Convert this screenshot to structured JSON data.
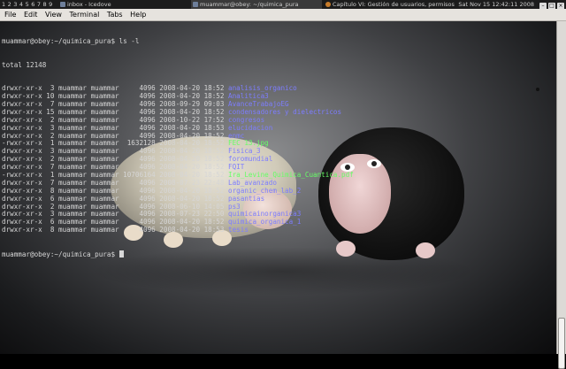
{
  "taskbar": {
    "workspaces": [
      "1",
      "2",
      "3",
      "4",
      "5",
      "6",
      "7",
      "8",
      "9"
    ],
    "tasks": [
      {
        "label": "inbox - Icedove",
        "active": false
      },
      {
        "label": "muammar@obey: ~/quimica_pura",
        "active": true
      },
      {
        "label": "Capítulo VI: Gestión de usuarios, permisos y gr...",
        "active": false
      }
    ],
    "clock": "Sat Nov 15 12:42:11 2008"
  },
  "menubar": [
    "File",
    "Edit",
    "View",
    "Terminal",
    "Tabs",
    "Help"
  ],
  "terminal": {
    "prompt_cmd": "muammar@obey:~/quimica_pura$ ls -l",
    "total": "total 12148",
    "entries": [
      {
        "perm": "drwxr-xr-x",
        "links": "3",
        "user": "muammar",
        "group": "muammar",
        "size": "4096",
        "date": "2008-04-20",
        "time": "18:52",
        "name": "analisis_organico",
        "kind": "dir"
      },
      {
        "perm": "drwxr-xr-x",
        "links": "10",
        "user": "muammar",
        "group": "muammar",
        "size": "4096",
        "date": "2008-04-20",
        "time": "18:52",
        "name": "Analitica3",
        "kind": "dir"
      },
      {
        "perm": "drwxr-xr-x",
        "links": "7",
        "user": "muammar",
        "group": "muammar",
        "size": "4096",
        "date": "2008-09-29",
        "time": "09:03",
        "name": "AvanceTrabajoEG",
        "kind": "dir"
      },
      {
        "perm": "drwxr-xr-x",
        "links": "15",
        "user": "muammar",
        "group": "muammar",
        "size": "4096",
        "date": "2008-04-20",
        "time": "18:52",
        "name": "condensadores y dielectricos",
        "kind": "dir"
      },
      {
        "perm": "drwxr-xr-x",
        "links": "2",
        "user": "muammar",
        "group": "muammar",
        "size": "4096",
        "date": "2008-10-22",
        "time": "17:52",
        "name": "congresos",
        "kind": "dir"
      },
      {
        "perm": "drwxr-xr-x",
        "links": "3",
        "user": "muammar",
        "group": "muammar",
        "size": "4096",
        "date": "2008-04-20",
        "time": "18:53",
        "name": "elucidacion",
        "kind": "dir"
      },
      {
        "perm": "drwxr-xr-x",
        "links": "2",
        "user": "muammar",
        "group": "muammar",
        "size": "4096",
        "date": "2008-04-20",
        "time": "18:52",
        "name": "enmc",
        "kind": "dir"
      },
      {
        "perm": "-rwxr-xr-x",
        "links": "1",
        "user": "muammar",
        "group": "muammar",
        "size": "1632128",
        "date": "2008-04-20",
        "time": "18:52",
        "name": "FEC 13.jpg",
        "kind": "exe"
      },
      {
        "perm": "drwxr-xr-x",
        "links": "3",
        "user": "muammar",
        "group": "muammar",
        "size": "4096",
        "date": "2008-04-20",
        "time": "18:52",
        "name": "Fisica_3",
        "kind": "dir"
      },
      {
        "perm": "drwxr-xr-x",
        "links": "2",
        "user": "muammar",
        "group": "muammar",
        "size": "4096",
        "date": "2008-04-20",
        "time": "18:52",
        "name": "foromundial",
        "kind": "dir"
      },
      {
        "perm": "drwxr-xr-x",
        "links": "7",
        "user": "muammar",
        "group": "muammar",
        "size": "4096",
        "date": "2008-04-20",
        "time": "18:52",
        "name": "FQIT",
        "kind": "dir"
      },
      {
        "perm": "-rwxr-xr-x",
        "links": "1",
        "user": "muammar",
        "group": "muammar",
        "size": "10706164",
        "date": "2008-04-20",
        "time": "18:52",
        "name": "Ira_Levine_Quimica_Cuantica.pdf",
        "kind": "pdf"
      },
      {
        "perm": "drwxr-xr-x",
        "links": "7",
        "user": "muammar",
        "group": "muammar",
        "size": "4096",
        "date": "2008-07-23",
        "time": "22:48",
        "name": "Lab_avanzado",
        "kind": "dir"
      },
      {
        "perm": "drwxr-xr-x",
        "links": "8",
        "user": "muammar",
        "group": "muammar",
        "size": "4096",
        "date": "2008-04-20",
        "time": "18:52",
        "name": "organic_chem_lab_2",
        "kind": "dir"
      },
      {
        "perm": "drwxr-xr-x",
        "links": "6",
        "user": "muammar",
        "group": "muammar",
        "size": "4096",
        "date": "2008-04-20",
        "time": "18:52",
        "name": "pasantias",
        "kind": "dir"
      },
      {
        "perm": "drwxr-xr-x",
        "links": "2",
        "user": "muammar",
        "group": "muammar",
        "size": "4096",
        "date": "2008-06-10",
        "time": "14:05",
        "name": "ps3",
        "kind": "dir"
      },
      {
        "perm": "drwxr-xr-x",
        "links": "3",
        "user": "muammar",
        "group": "muammar",
        "size": "4096",
        "date": "2008-07-23",
        "time": "22:50",
        "name": "quimicainorganica3",
        "kind": "dir"
      },
      {
        "perm": "drwxr-xr-x",
        "links": "6",
        "user": "muammar",
        "group": "muammar",
        "size": "4096",
        "date": "2008-04-20",
        "time": "18:52",
        "name": "quimica_organica_1",
        "kind": "dir"
      },
      {
        "perm": "drwxr-xr-x",
        "links": "8",
        "user": "muammar",
        "group": "muammar",
        "size": "4096",
        "date": "2008-04-20",
        "time": "18:53",
        "name": "tesis",
        "kind": "dir"
      }
    ],
    "final_prompt": "muammar@obey:~/quimica_pura$"
  },
  "colors": {
    "dir": "#7d7dff",
    "exe": "#66ff66",
    "pdf": "#66ff66",
    "text": "#d8d8d8"
  }
}
